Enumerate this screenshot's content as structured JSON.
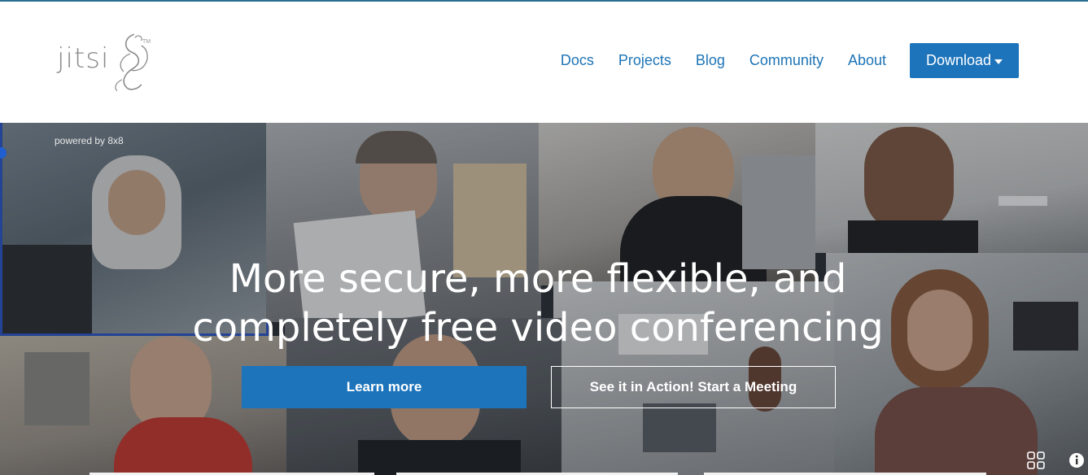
{
  "logo": {
    "text": "jitsi",
    "trademark": "TM"
  },
  "nav": {
    "items": [
      "Docs",
      "Projects",
      "Blog",
      "Community",
      "About"
    ],
    "download_label": "Download"
  },
  "hero": {
    "powered_by": "powered by 8x8",
    "headline_line1": "More secure, more flexible, and",
    "headline_line2": "completely free video conferencing",
    "learn_more": "Learn more",
    "start_meeting": "See it in Action! Start a Meeting"
  },
  "colors": {
    "accent": "#1d74bb",
    "nav_link": "#1d74b6",
    "logo_gray": "#8a8a8a"
  },
  "icons": [
    "jitsi-logo-icon",
    "caret-down-icon",
    "tile-view-icon",
    "info-icon"
  ]
}
